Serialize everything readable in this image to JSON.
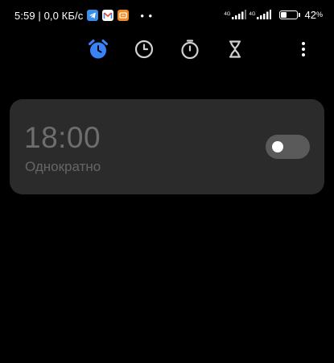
{
  "status_bar": {
    "time_speed": "5:59 | 0,0 КБ/с",
    "notification_icons": [
      "telegram-icon",
      "gmail-icon",
      "mi-app-icon"
    ],
    "more_notifications": "• •",
    "network_top": "4G",
    "network_bottom": "4G",
    "battery_level": 0.42,
    "battery_text": "42",
    "battery_percent_sign": "%"
  },
  "tabs": [
    {
      "id": "alarm",
      "icon": "alarm-clock-icon",
      "active": true
    },
    {
      "id": "clock",
      "icon": "clock-icon",
      "active": false
    },
    {
      "id": "stopwatch",
      "icon": "stopwatch-icon",
      "active": false
    },
    {
      "id": "timer",
      "icon": "hourglass-icon",
      "active": false
    }
  ],
  "colors": {
    "background": "#000000",
    "accent": "#3b82f6",
    "card": "#2b2b2b",
    "inactive_icon": "#d0d0d0",
    "disabled_text": "#6e6e6e"
  },
  "alarm": {
    "time": "18:00",
    "repeat": "Однократно",
    "enabled": false
  }
}
